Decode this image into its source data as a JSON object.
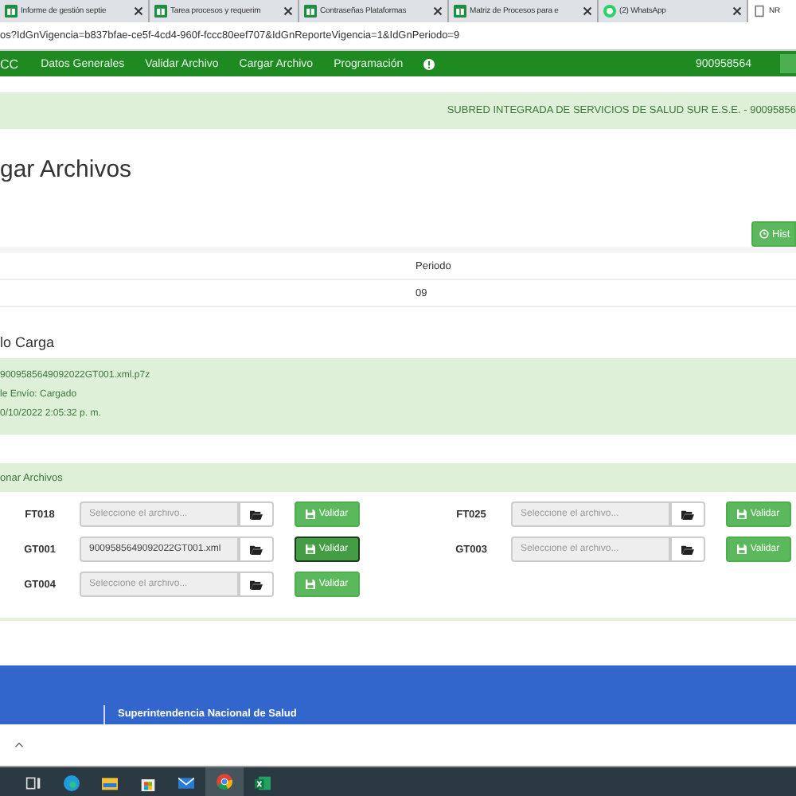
{
  "browser": {
    "tabs": [
      {
        "title": "Informe de gestión septie",
        "kind": "sheet",
        "selected": false
      },
      {
        "title": "Tarea procesos y requerim",
        "kind": "sheet",
        "selected": false
      },
      {
        "title": "Contraseñas Plataformas",
        "kind": "sheet",
        "selected": false
      },
      {
        "title": "Matriz de Procesos para e",
        "kind": "sheet",
        "selected": false
      },
      {
        "title": "(2) WhatsApp",
        "kind": "chat",
        "selected": false
      },
      {
        "title": "NR",
        "kind": "page",
        "selected": true
      }
    ],
    "url": "os?IdGnVigencia=b837bfae-ce5f-4cd4-960f-fccc80eef707&IdGnReporteVigencia=1&IdGnPeriodo=9"
  },
  "navbar": {
    "brand": "CC",
    "items": [
      "Datos Generales",
      "Validar Archivo",
      "Cargar Archivo",
      "Programación"
    ],
    "user": "900958564"
  },
  "entity_banner": "SUBRED INTEGRADA DE SERVICIOS DE SALUD SUR E.S.E. - 90095856",
  "page_title": "gar Archivos",
  "history_button": "Hist",
  "period_table": {
    "header": "Periodo",
    "value": "09"
  },
  "load_status": {
    "title": "lo Carga",
    "lines": [
      "9009585649092022GT001.xml.p7z",
      "le Envío: Cargado",
      "0/10/2022 2:05:32 p. m."
    ]
  },
  "files_panel": {
    "title": "onar Archivos",
    "rows": [
      {
        "code": "FT018",
        "placeholder": "Seleccione el archivo...",
        "value": "",
        "button": "Validar",
        "focused": false
      },
      {
        "code": "FT025",
        "placeholder": "Seleccione el archivo...",
        "value": "",
        "button": "Validar",
        "focused": false
      },
      {
        "code": "GT001",
        "value": "9009585649092022GT001.xml",
        "button": "Validar",
        "focused": true
      },
      {
        "code": "GT003",
        "placeholder": "Seleccione el archivo...",
        "value": "",
        "button": "Validar",
        "focused": false
      },
      {
        "code": "GT004",
        "placeholder": "Seleccione el archivo...",
        "value": "",
        "button": "Validar",
        "focused": false
      }
    ]
  },
  "footer": {
    "title": "Superintendencia Nacional de Salud"
  },
  "taskbar": {
    "apps": [
      {
        "kind": "taskview",
        "selected": false
      },
      {
        "kind": "edge",
        "selected": false
      },
      {
        "kind": "files",
        "selected": false
      },
      {
        "kind": "store",
        "selected": false
      },
      {
        "kind": "mail",
        "selected": false
      },
      {
        "kind": "chrome",
        "selected": true
      },
      {
        "kind": "excel",
        "selected": false
      }
    ]
  }
}
